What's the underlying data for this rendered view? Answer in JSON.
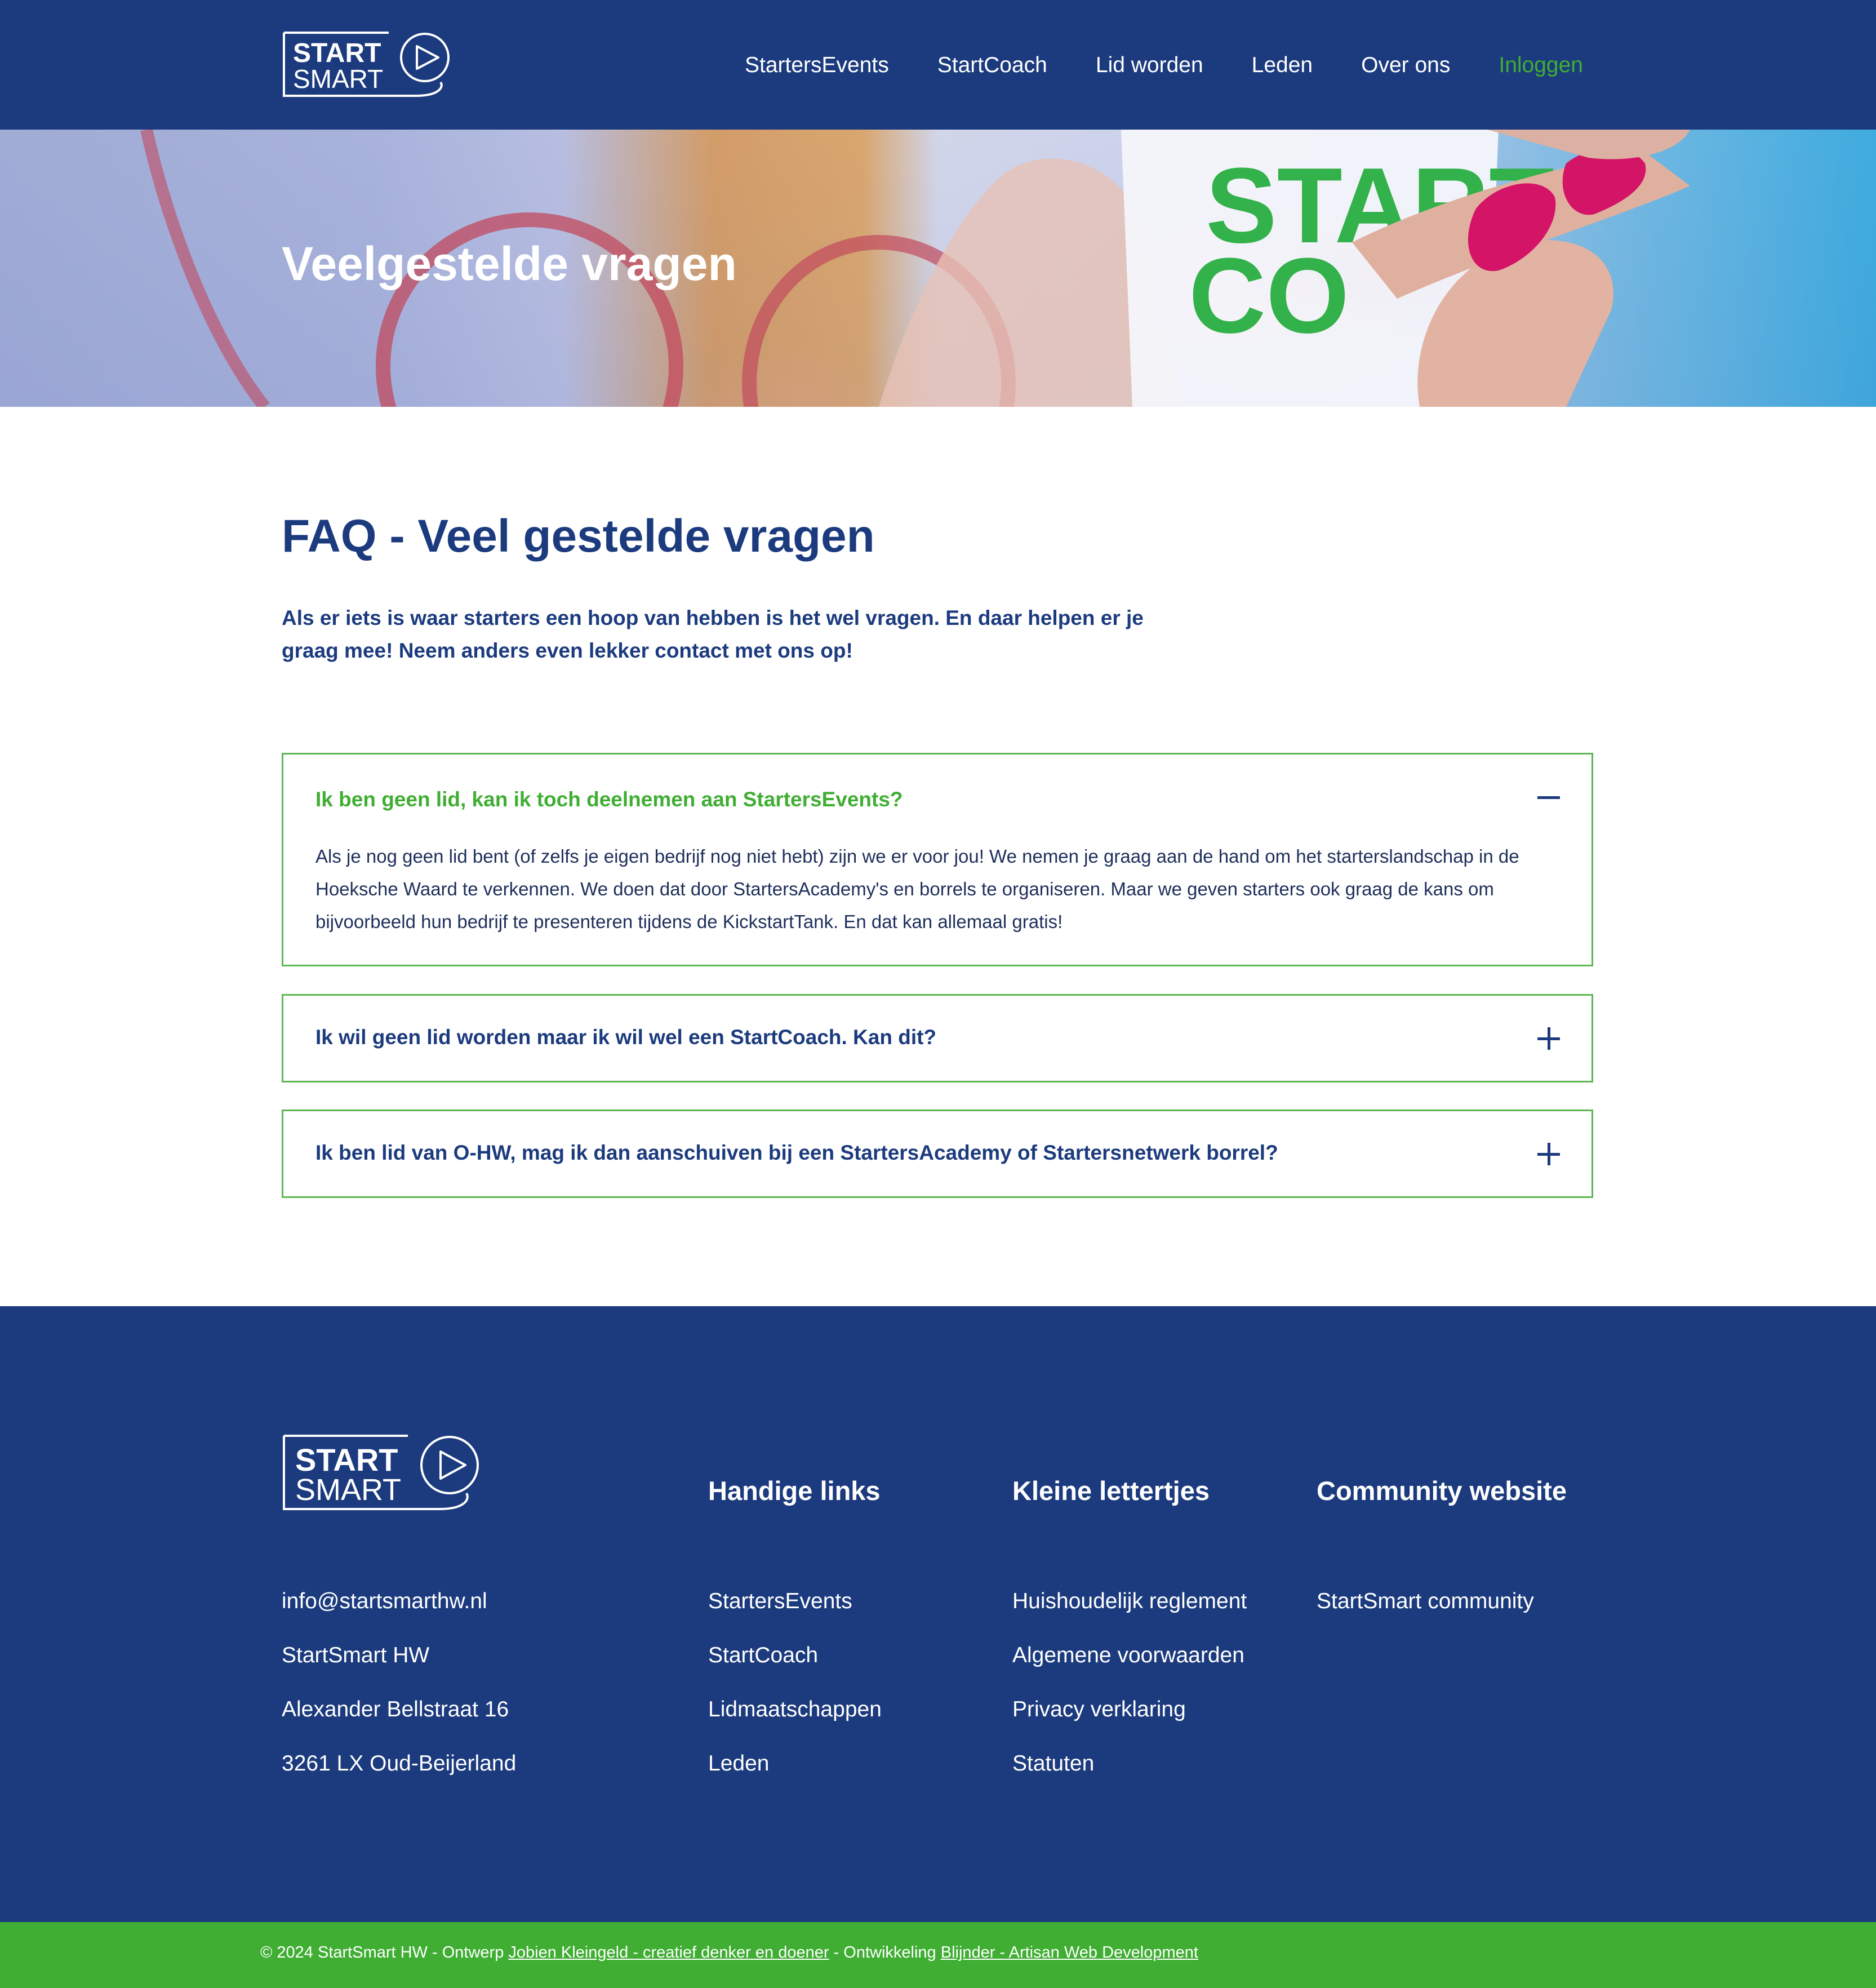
{
  "brand": {
    "line1": "START",
    "line2": "SMART"
  },
  "nav": {
    "items": [
      "StartersEvents",
      "StartCoach",
      "Lid worden",
      "Leden",
      "Over ons"
    ],
    "login": "Inloggen"
  },
  "hero": {
    "title": "Veelgestelde vragen",
    "image_text_1": "START",
    "image_text_2": "CO"
  },
  "main": {
    "heading": "FAQ - Veel gestelde vragen",
    "intro": "Als er iets is waar starters een hoop van hebben is het wel vragen. En daar helpen er je graag mee! Neem anders even lekker contact met ons op!"
  },
  "faq": [
    {
      "question": "Ik ben geen lid, kan ik toch deelnemen aan StartersEvents?",
      "answer": "Als je nog geen lid bent (of zelfs je eigen bedrijf nog niet hebt) zijn we er voor jou! We nemen je graag aan de hand om het starterslandschap in de Hoeksche Waard te verkennen. We doen dat door StartersAcademy's en borrels te organiseren. Maar we geven starters ook graag de kans om bijvoorbeeld hun bedrijf te presenteren tijdens de KickstartTank. En dat kan allemaal gratis!",
      "expanded": true
    },
    {
      "question": "Ik wil geen lid worden maar ik wil wel een StartCoach. Kan dit?",
      "expanded": false
    },
    {
      "question": "Ik ben lid van O-HW, mag ik dan aanschuiven bij een StartersAcademy of Startersnetwerk borrel?",
      "expanded": false
    }
  ],
  "footer": {
    "contact": [
      "info@startsmarthw.nl",
      "StartSmart HW",
      "Alexander Bellstraat 16",
      "3261 LX Oud-Beijerland"
    ],
    "handy_links": {
      "title": "Handige links",
      "items": [
        "StartersEvents",
        "StartCoach",
        "Lidmaatschappen",
        "Leden"
      ]
    },
    "fine_print": {
      "title": "Kleine lettertjes",
      "items": [
        "Huishoudelijk reglement",
        "Algemene voorwaarden",
        "Privacy verklaring",
        "Statuten"
      ]
    },
    "community": {
      "title": "Community website",
      "items": [
        "StartSmart community"
      ]
    }
  },
  "bottom_bar": {
    "copyright": "© 2024 StartSmart HW - Ontwerp ",
    "designer": "Jobien Kleingeld - creatief denker en doener",
    "dev_prefix": " - Ontwikkeling ",
    "developer": "Blijnder - Artisan Web Development"
  },
  "colors": {
    "primary": "#1c3b7e",
    "accent": "#3fae33",
    "border": "#5eb656"
  },
  "icons": {
    "expanded": "minus-icon",
    "collapsed": "plus-icon"
  }
}
